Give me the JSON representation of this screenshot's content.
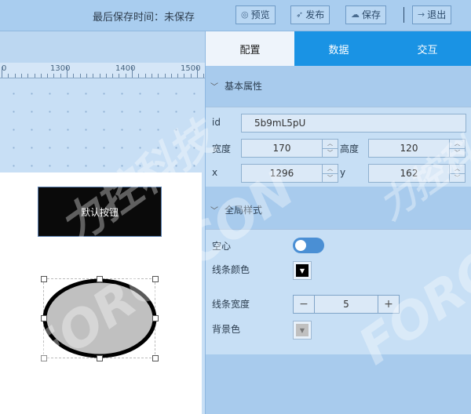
{
  "toolbar": {
    "save_time_label": "最后保存时间：未保存",
    "preview_label": "预览",
    "publish_label": "发布",
    "save_label": "保存",
    "exit_label": "退出"
  },
  "ruler": {
    "ticks": [
      "1300",
      "1400",
      "1500"
    ]
  },
  "canvas": {
    "default_button_label": "默认按钮"
  },
  "panel": {
    "tabs": [
      "配置",
      "数据",
      "交互"
    ],
    "basic_section": "基本属性",
    "id_label": "id",
    "id_value": "5b9mL5pU",
    "width_label": "宽度",
    "width_value": "170",
    "height_label": "高度",
    "height_value": "120",
    "x_label": "x",
    "x_value": "1296",
    "y_label": "y",
    "y_value": "162",
    "global_section": "全局样式",
    "hollow_label": "空心",
    "line_color_label": "线条颜色",
    "line_width_label": "线条宽度",
    "line_width_value": "5",
    "bg_color_label": "背景色"
  },
  "watermark": {
    "text_cn": "力控科技",
    "text_en": "FORCECON"
  },
  "colors": {
    "accent_tab": "#1a93e4",
    "line_color": "#000000",
    "bg_color": "#c0c0c0",
    "toggle_on": "#4a8fd4"
  }
}
